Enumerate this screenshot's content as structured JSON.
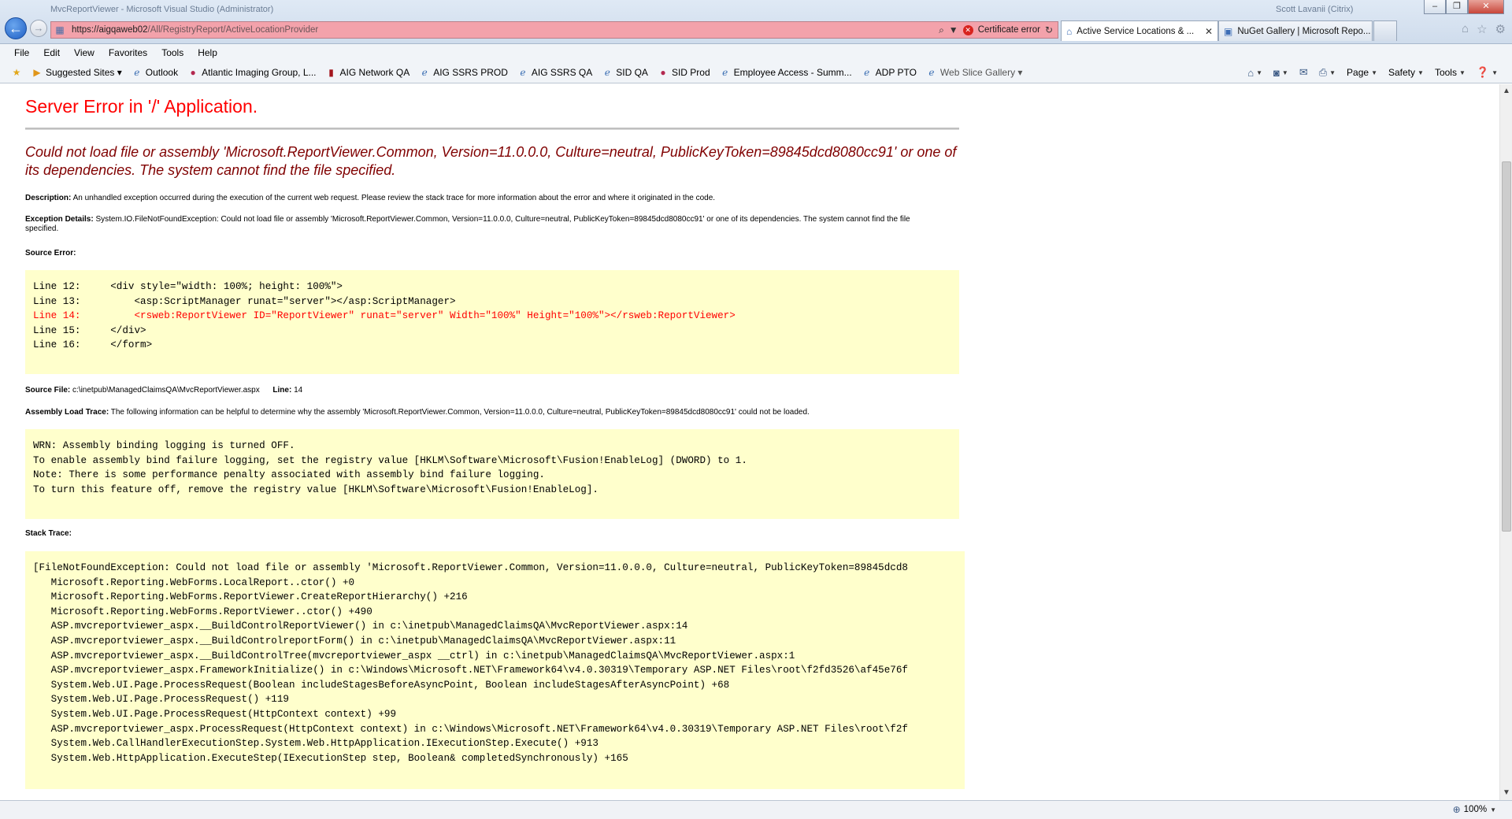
{
  "window": {
    "title": "MvcReportViewer - Microsoft Visual Studio (Administrator)",
    "user": "Scott Lavanii (Citrix)",
    "btn_minimize": "–",
    "btn_restore": "❐",
    "btn_close": "✕"
  },
  "address": {
    "url_host": "https://aigqaweb02",
    "url_path": "/All/RegistryReport/ActiveLocationProvider",
    "cert_error": "Certificate error"
  },
  "tabs": [
    {
      "label": "Active Service Locations & ...",
      "close": "✕"
    },
    {
      "label": "NuGet Gallery | Microsoft Repo...",
      "close": "✕"
    }
  ],
  "menu": [
    "File",
    "Edit",
    "View",
    "Favorites",
    "Tools",
    "Help"
  ],
  "favorites": [
    {
      "label": "Suggested Sites ▾",
      "icon": "suggested-sites-icon"
    },
    {
      "label": "Outlook",
      "icon": "ie-page-icon"
    },
    {
      "label": "Atlantic Imaging Group, L...",
      "icon": "globe-icon"
    },
    {
      "label": "AIG Network QA",
      "icon": "bookmark-icon"
    },
    {
      "label": "AIG SSRS PROD",
      "icon": "ie-page-icon"
    },
    {
      "label": "AIG SSRS QA",
      "icon": "ie-page-icon"
    },
    {
      "label": "SID QA",
      "icon": "ie-page-icon"
    },
    {
      "label": "SID Prod",
      "icon": "globe-icon"
    },
    {
      "label": "Employee Access - Summ...",
      "icon": "ie-page-icon"
    },
    {
      "label": "ADP PTO",
      "icon": "ie-page-icon"
    },
    {
      "label": "Web Slice Gallery ▾",
      "icon": "web-slice-icon"
    }
  ],
  "commands": {
    "page": "Page",
    "safety": "Safety",
    "tools": "Tools"
  },
  "error": {
    "title": "Server Error in '/' Application.",
    "message": "Could not load file or assembly 'Microsoft.ReportViewer.Common, Version=11.0.0.0, Culture=neutral, PublicKeyToken=89845dcd8080cc91' or one of its dependencies. The system cannot find the file specified.",
    "description_label": "Description:",
    "description": "An unhandled exception occurred during the execution of the current web request. Please review the stack trace for more information about the error and where it originated in the code.",
    "exception_label": "Exception Details:",
    "exception": "System.IO.FileNotFoundException: Could not load file or assembly 'Microsoft.ReportViewer.Common, Version=11.0.0.0, Culture=neutral, PublicKeyToken=89845dcd8080cc91' or one of its dependencies. The system cannot find the file specified.",
    "source_error_label": "Source Error:",
    "source_lines": [
      {
        "text": "Line 12:     <div style=\"width: 100%; height: 100%\">",
        "highlight": false
      },
      {
        "text": "Line 13:         <asp:ScriptManager runat=\"server\"></asp:ScriptManager>",
        "highlight": false
      },
      {
        "text": "Line 14:         <rsweb:ReportViewer ID=\"ReportViewer\" runat=\"server\" Width=\"100%\" Height=\"100%\"></rsweb:ReportViewer>",
        "highlight": true
      },
      {
        "text": "Line 15:     </div>",
        "highlight": false
      },
      {
        "text": "Line 16:     </form>",
        "highlight": false
      }
    ],
    "source_file_label": "Source File:",
    "source_file": "c:\\inetpub\\ManagedClaimsQA\\MvcReportViewer.aspx",
    "line_label": "Line:",
    "line_number": "14",
    "assembly_trace_label": "Assembly Load Trace:",
    "assembly_trace": "The following information can be helpful to determine why the assembly 'Microsoft.ReportViewer.Common, Version=11.0.0.0, Culture=neutral, PublicKeyToken=89845dcd8080cc91' could not be loaded.",
    "assembly_lines": [
      "WRN: Assembly binding logging is turned OFF.",
      "To enable assembly bind failure logging, set the registry value [HKLM\\Software\\Microsoft\\Fusion!EnableLog] (DWORD) to 1.",
      "Note: There is some performance penalty associated with assembly bind failure logging.",
      "To turn this feature off, remove the registry value [HKLM\\Software\\Microsoft\\Fusion!EnableLog]."
    ],
    "stack_trace_label": "Stack Trace:",
    "stack_lines": [
      "[FileNotFoundException: Could not load file or assembly 'Microsoft.ReportViewer.Common, Version=11.0.0.0, Culture=neutral, PublicKeyToken=89845dcd8",
      "   Microsoft.Reporting.WebForms.LocalReport..ctor() +0",
      "   Microsoft.Reporting.WebForms.ReportViewer.CreateReportHierarchy() +216",
      "   Microsoft.Reporting.WebForms.ReportViewer..ctor() +490",
      "   ASP.mvcreportviewer_aspx.__BuildControlReportViewer() in c:\\inetpub\\ManagedClaimsQA\\MvcReportViewer.aspx:14",
      "   ASP.mvcreportviewer_aspx.__BuildControlreportForm() in c:\\inetpub\\ManagedClaimsQA\\MvcReportViewer.aspx:11",
      "   ASP.mvcreportviewer_aspx.__BuildControlTree(mvcreportviewer_aspx __ctrl) in c:\\inetpub\\ManagedClaimsQA\\MvcReportViewer.aspx:1",
      "   ASP.mvcreportviewer_aspx.FrameworkInitialize() in c:\\Windows\\Microsoft.NET\\Framework64\\v4.0.30319\\Temporary ASP.NET Files\\root\\f2fd3526\\af45e76f",
      "   System.Web.UI.Page.ProcessRequest(Boolean includeStagesBeforeAsyncPoint, Boolean includeStagesAfterAsyncPoint) +68",
      "   System.Web.UI.Page.ProcessRequest() +119",
      "   System.Web.UI.Page.ProcessRequest(HttpContext context) +99",
      "   ASP.mvcreportviewer_aspx.ProcessRequest(HttpContext context) in c:\\Windows\\Microsoft.NET\\Framework64\\v4.0.30319\\Temporary ASP.NET Files\\root\\f2f",
      "   System.Web.CallHandlerExecutionStep.System.Web.HttpApplication.IExecutionStep.Execute() +913",
      "   System.Web.HttpApplication.ExecuteStep(IExecutionStep step, Boolean& completedSynchronously) +165"
    ]
  },
  "status": {
    "zoom": "100%"
  }
}
